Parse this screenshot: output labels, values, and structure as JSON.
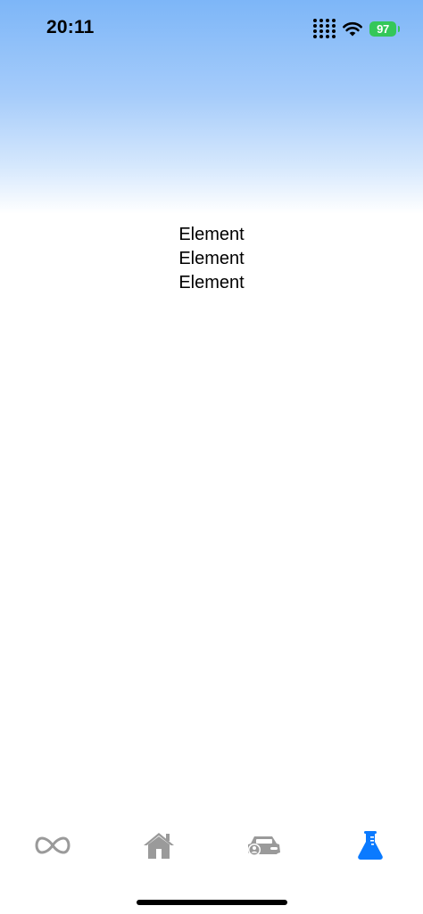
{
  "status_bar": {
    "time": "20:11",
    "battery_level": "97",
    "icons": [
      "cellular-signal-icon",
      "wifi-icon",
      "battery-icon"
    ]
  },
  "main": {
    "items": [
      "Element",
      "Element",
      "Element"
    ]
  },
  "tab_bar": {
    "tabs": [
      {
        "icon": "infinity-icon",
        "selected": false
      },
      {
        "icon": "house-icon",
        "selected": false
      },
      {
        "icon": "car-profile-icon",
        "selected": false
      },
      {
        "icon": "flask-icon",
        "selected": true
      }
    ]
  },
  "colors": {
    "header_gradient_top": "#7db6f8",
    "accent": "#0a7aff",
    "inactive_tab": "#9a9a9a",
    "battery": "#34c759"
  }
}
